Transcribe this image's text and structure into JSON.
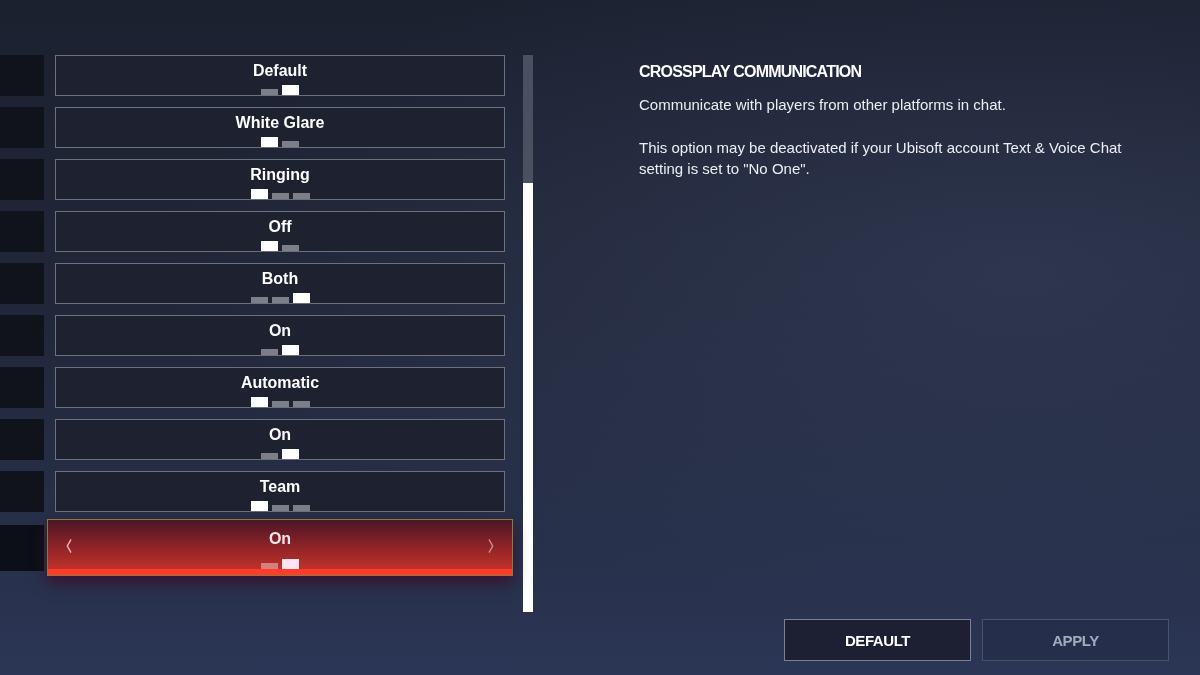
{
  "settings": [
    {
      "value": "Default",
      "focused": false,
      "segments": [
        {
          "selected": false
        },
        {
          "selected": true
        }
      ]
    },
    {
      "value": "White Glare",
      "focused": false,
      "segments": [
        {
          "selected": true
        },
        {
          "selected": false
        }
      ]
    },
    {
      "value": "Ringing",
      "focused": false,
      "segments": [
        {
          "selected": true
        },
        {
          "selected": false
        },
        {
          "selected": false
        }
      ]
    },
    {
      "value": "Off",
      "focused": false,
      "segments": [
        {
          "selected": true
        },
        {
          "selected": false
        }
      ]
    },
    {
      "value": "Both",
      "focused": false,
      "segments": [
        {
          "selected": false
        },
        {
          "selected": false
        },
        {
          "selected": true
        }
      ]
    },
    {
      "value": "On",
      "focused": false,
      "segments": [
        {
          "selected": false
        },
        {
          "selected": true
        }
      ]
    },
    {
      "value": "Automatic",
      "focused": false,
      "segments": [
        {
          "selected": true
        },
        {
          "selected": false
        },
        {
          "selected": false
        }
      ]
    },
    {
      "value": "On",
      "focused": false,
      "segments": [
        {
          "selected": false
        },
        {
          "selected": true
        }
      ]
    },
    {
      "value": "Team",
      "focused": false,
      "segments": [
        {
          "selected": true
        },
        {
          "selected": false
        },
        {
          "selected": false
        }
      ]
    },
    {
      "value": "On",
      "focused": true,
      "segments": [
        {
          "selected": false
        },
        {
          "selected": true
        }
      ]
    }
  ],
  "detail": {
    "title": "CROSSPLAY COMMUNICATION",
    "description": [
      "Communicate with players from other platforms in chat.",
      "This option may be deactivated if your Ubisoft account Text & Voice Chat setting is set to \"No One\"."
    ]
  },
  "buttons": [
    {
      "label": "DEFAULT",
      "disabled": false
    },
    {
      "label": "APPLY",
      "disabled": true
    }
  ]
}
